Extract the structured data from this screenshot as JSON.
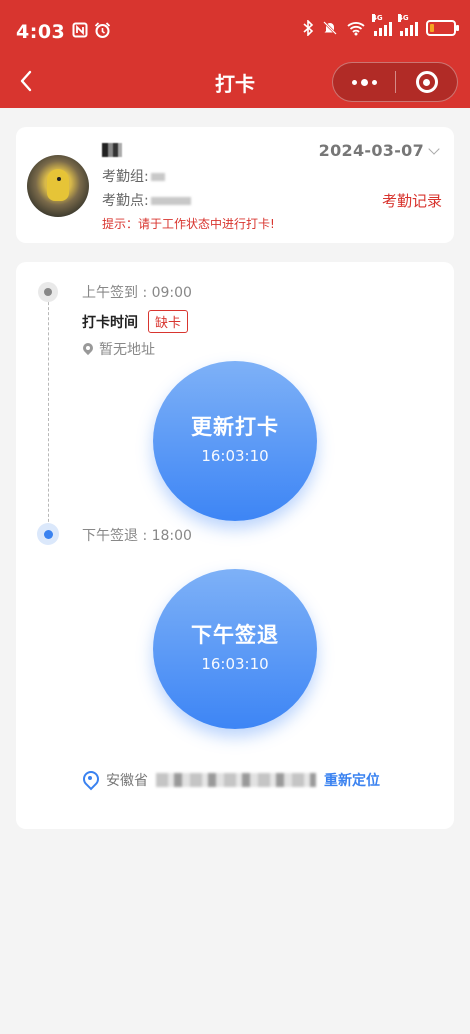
{
  "status_bar": {
    "time": "4:03",
    "left_icons": [
      "nfc-icon",
      "alarm-icon"
    ],
    "right_icons": [
      "bluetooth-icon",
      "mute-icon",
      "wifi-icon",
      "signal-4g-icon",
      "signal-4g-icon",
      "battery-icon"
    ],
    "signal_label": "4G"
  },
  "nav": {
    "title": "打卡",
    "back_icon": "back-arrow-icon",
    "more_icon": "more-dots-icon",
    "close_icon": "target-close-icon"
  },
  "user": {
    "group_label": "考勤组:",
    "point_label": "考勤点:",
    "tip": "提示：请于工作状态中进行打卡!",
    "date": "2024-03-07",
    "record_link": "考勤记录"
  },
  "attendance": {
    "am_label": "上午签到 : 09:00",
    "punch_time_label": "打卡时间",
    "missing_badge": "缺卡",
    "no_address": "暂无地址",
    "update_button": "更新打卡",
    "update_time": "16:03:10",
    "pm_label": "下午签退 : 18:00",
    "checkout_button": "下午签退",
    "checkout_time": "16:03:10",
    "location_prefix": "安徽省",
    "relocate": "重新定位"
  },
  "colors": {
    "brand_red": "#d8352f",
    "button_blue": "#3d85f5",
    "link_blue": "#3a82f0"
  }
}
